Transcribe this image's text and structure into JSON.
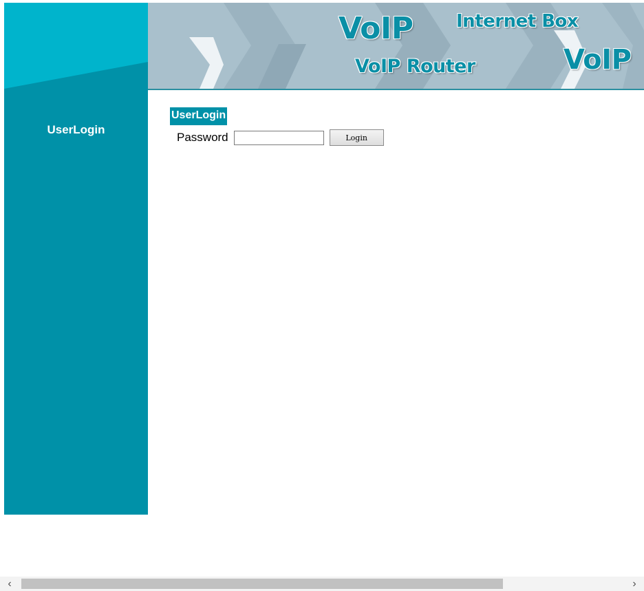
{
  "sidebar": {
    "items": [
      {
        "label": "UserLogin"
      }
    ]
  },
  "banner": {
    "voip_main": "VoIP",
    "internet_box": "Internet Box",
    "voip_router": "VoIP Router",
    "voip_right": "VoIP"
  },
  "main": {
    "section_title": "UserLogin",
    "password_label": "Password",
    "password_value": "",
    "login_button": "Login"
  },
  "scrollbar": {
    "left_arrow": "‹",
    "right_arrow": "›"
  },
  "colors": {
    "sidebar": "#0091a8",
    "sidebar_top": "#00b4cc",
    "banner_bg": "#a9c0cc",
    "accent_text": "#0a8fa6"
  }
}
